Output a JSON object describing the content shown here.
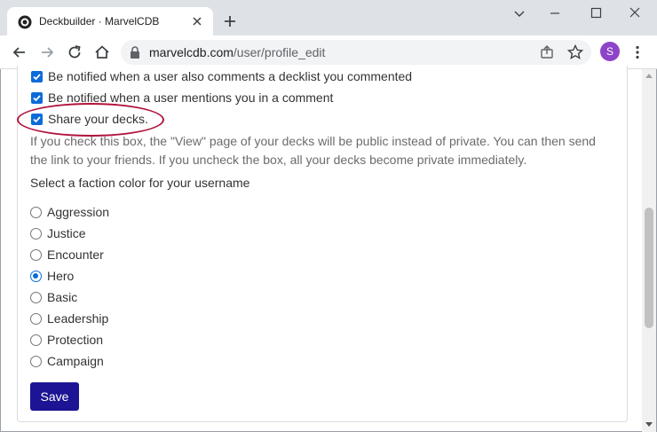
{
  "browser": {
    "tab_title": "Deckbuilder · MarvelCDB",
    "url_host": "marvelcdb.com",
    "url_path": "/user/profile_edit",
    "profile_initial": "S",
    "profile_color": "#8e44c8"
  },
  "notifications": {
    "comment_decklist": "Be notified when a user also comments a decklist you commented",
    "mentions": "Be notified when a user mentions you in a comment",
    "share_decks": "Share your decks."
  },
  "share_help": "If you check this box, the \"View\" page of your decks will be public instead of private. You can then send the link to your friends. If you uncheck the box, all your decks become private immediately.",
  "faction_prompt": "Select a faction color for your username",
  "factions": [
    {
      "label": "Aggression",
      "checked": false
    },
    {
      "label": "Justice",
      "checked": false
    },
    {
      "label": "Encounter",
      "checked": false
    },
    {
      "label": "Hero",
      "checked": true
    },
    {
      "label": "Basic",
      "checked": false
    },
    {
      "label": "Leadership",
      "checked": false
    },
    {
      "label": "Protection",
      "checked": false
    },
    {
      "label": "Campaign",
      "checked": false
    }
  ],
  "save_label": "Save",
  "colors": {
    "accent": "#0b6bd9",
    "save_button": "#1c1494",
    "highlight": "#b0143c"
  }
}
